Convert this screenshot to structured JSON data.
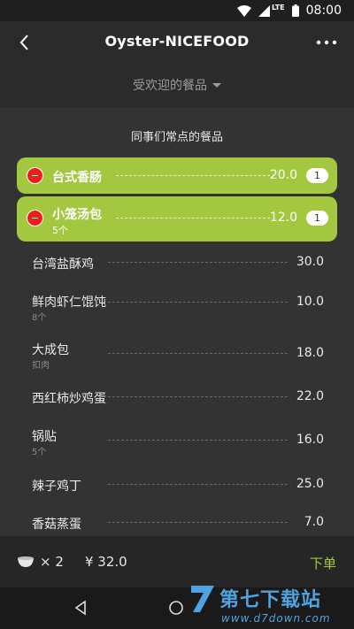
{
  "status_bar": {
    "network": "LTE",
    "time": "08:00"
  },
  "app_bar": {
    "title": "Oyster-NICEFOOD"
  },
  "category": {
    "label": "受欢迎的餐品"
  },
  "section_title": "同事们常点的餐品",
  "selected_items": [
    {
      "name": "台式香肠",
      "sub": "",
      "price": "20.0",
      "qty": "1"
    },
    {
      "name": "小笼汤包",
      "sub": "5个",
      "price": "12.0",
      "qty": "1"
    }
  ],
  "menu_items": [
    {
      "name": "台湾盐酥鸡",
      "sub": "",
      "price": "30.0"
    },
    {
      "name": "鲜肉虾仁馄饨",
      "sub": "8个",
      "price": "10.0"
    },
    {
      "name": "大成包",
      "sub": "扣肉",
      "price": "18.0"
    },
    {
      "name": "西红柿炒鸡蛋",
      "sub": "",
      "price": "22.0"
    },
    {
      "name": "锅贴",
      "sub": "5个",
      "price": "16.0"
    },
    {
      "name": "辣子鸡丁",
      "sub": "",
      "price": "25.0"
    },
    {
      "name": "香菇蒸蛋",
      "sub": "",
      "price": "7.0"
    }
  ],
  "cart": {
    "count": "× 2",
    "total": "¥ 32.0",
    "order_label": "下单"
  },
  "watermark": {
    "text": "第七下载站",
    "url": "www.d7down.com"
  },
  "colors": {
    "accent": "#a3c840",
    "remove": "#e7201c",
    "background": "#333333"
  }
}
